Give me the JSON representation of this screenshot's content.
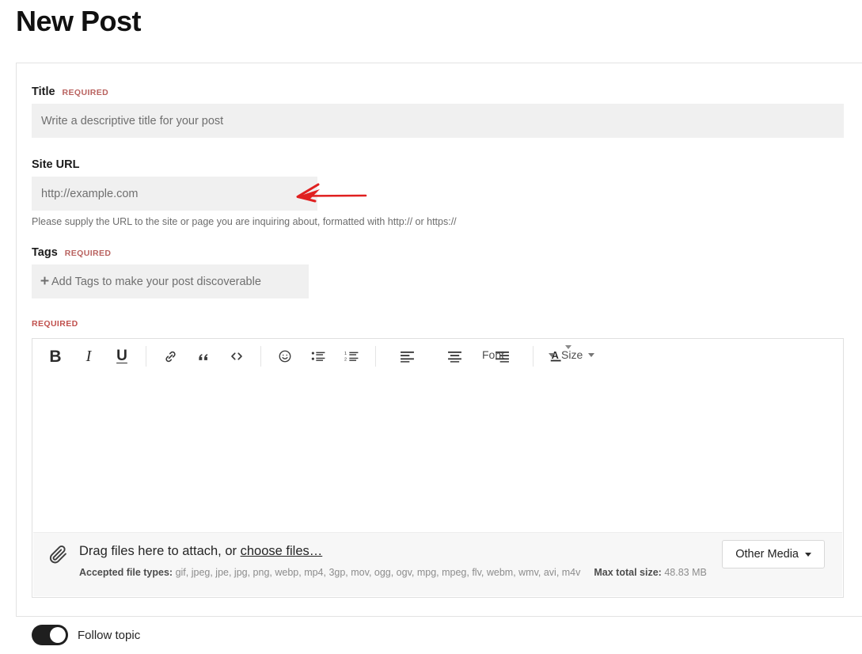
{
  "page": {
    "title": "New Post"
  },
  "form": {
    "title_field": {
      "label": "Title",
      "required_tag": "REQUIRED",
      "placeholder": "Write a descriptive title for your post",
      "value": ""
    },
    "site_url_field": {
      "label": "Site URL",
      "placeholder": "http://example.com",
      "value": "",
      "help": "Please supply the URL to the site or page you are inquiring about, formatted with http:// or https://"
    },
    "tags_field": {
      "label": "Tags",
      "required_tag": "REQUIRED",
      "plus_icon": "plus-icon",
      "placeholder": "Add Tags to make your post discoverable"
    },
    "body_field": {
      "required_tag": "REQUIRED"
    }
  },
  "editor": {
    "toolbar": {
      "bold": {
        "label": "B",
        "icon": "bold-icon"
      },
      "italic": {
        "label": "I",
        "icon": "italic-icon"
      },
      "underline": {
        "label": "U",
        "icon": "underline-icon"
      },
      "link": {
        "icon": "link-icon"
      },
      "quote": {
        "label": "”",
        "icon": "blockquote-icon"
      },
      "code": {
        "label": "<>",
        "icon": "code-icon"
      },
      "emoji": {
        "icon": "smiley-icon"
      },
      "bullet_list": {
        "icon": "bullet-list-icon"
      },
      "numbered_list": {
        "icon": "numbered-list-icon"
      },
      "align_left": {
        "icon": "align-left-icon"
      },
      "align_center": {
        "icon": "align-center-icon"
      },
      "align_right": {
        "icon": "align-right-icon"
      },
      "text_color": {
        "label": "A",
        "icon": "text-color-icon"
      },
      "font": {
        "label": "Font",
        "caret_icon": "chevron-down-icon"
      },
      "size": {
        "label": "Size",
        "caret_icon": "chevron-down-icon"
      }
    },
    "content": ""
  },
  "attachments": {
    "clip_icon": "paperclip-icon",
    "drag_text_before": "Drag files here to attach, or ",
    "choose_files_link": "choose files…",
    "accepted_label": "Accepted file types:",
    "accepted_types": "gif, jpeg, jpe, jpg, png, webp, mp4, 3gp, mov, ogg, ogv, mpg, mpeg, flv, webm, wmv, avi, m4v",
    "max_size_label": "Max total size:",
    "max_size_value": "48.83 MB",
    "other_media_button": "Other Media",
    "other_media_caret": "chevron-down-icon"
  },
  "follow": {
    "label": "Follow topic",
    "state": "on"
  },
  "annotation": {
    "arrow_color": "#e02020",
    "target": "site-url-input"
  },
  "colors": {
    "required": "#c0504d",
    "input_background": "#f0f0f0",
    "toggle_on": "#1f1f1f",
    "card_border": "#e3e3e3"
  }
}
